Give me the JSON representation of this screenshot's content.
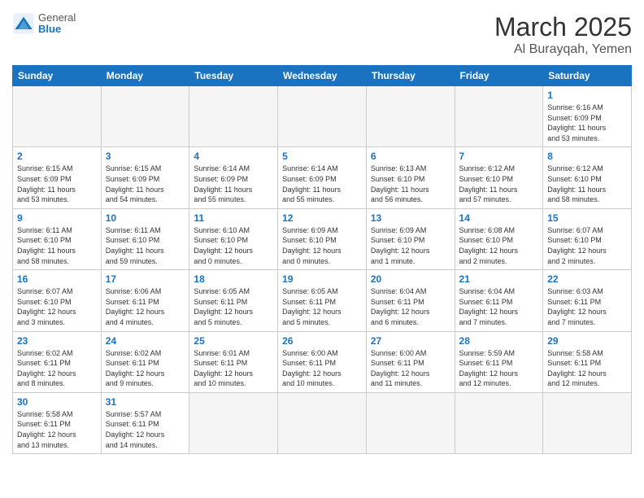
{
  "header": {
    "logo_general": "General",
    "logo_blue": "Blue",
    "title": "March 2025",
    "location": "Al Burayqah, Yemen"
  },
  "days_of_week": [
    "Sunday",
    "Monday",
    "Tuesday",
    "Wednesday",
    "Thursday",
    "Friday",
    "Saturday"
  ],
  "weeks": [
    [
      {
        "day": null,
        "info": ""
      },
      {
        "day": null,
        "info": ""
      },
      {
        "day": null,
        "info": ""
      },
      {
        "day": null,
        "info": ""
      },
      {
        "day": null,
        "info": ""
      },
      {
        "day": null,
        "info": ""
      },
      {
        "day": "1",
        "info": "Sunrise: 6:16 AM\nSunset: 6:09 PM\nDaylight: 11 hours\nand 53 minutes."
      }
    ],
    [
      {
        "day": "2",
        "info": "Sunrise: 6:15 AM\nSunset: 6:09 PM\nDaylight: 11 hours\nand 53 minutes."
      },
      {
        "day": "3",
        "info": "Sunrise: 6:15 AM\nSunset: 6:09 PM\nDaylight: 11 hours\nand 54 minutes."
      },
      {
        "day": "4",
        "info": "Sunrise: 6:14 AM\nSunset: 6:09 PM\nDaylight: 11 hours\nand 55 minutes."
      },
      {
        "day": "5",
        "info": "Sunrise: 6:14 AM\nSunset: 6:09 PM\nDaylight: 11 hours\nand 55 minutes."
      },
      {
        "day": "6",
        "info": "Sunrise: 6:13 AM\nSunset: 6:10 PM\nDaylight: 11 hours\nand 56 minutes."
      },
      {
        "day": "7",
        "info": "Sunrise: 6:12 AM\nSunset: 6:10 PM\nDaylight: 11 hours\nand 57 minutes."
      },
      {
        "day": "8",
        "info": "Sunrise: 6:12 AM\nSunset: 6:10 PM\nDaylight: 11 hours\nand 58 minutes."
      }
    ],
    [
      {
        "day": "9",
        "info": "Sunrise: 6:11 AM\nSunset: 6:10 PM\nDaylight: 11 hours\nand 58 minutes."
      },
      {
        "day": "10",
        "info": "Sunrise: 6:11 AM\nSunset: 6:10 PM\nDaylight: 11 hours\nand 59 minutes."
      },
      {
        "day": "11",
        "info": "Sunrise: 6:10 AM\nSunset: 6:10 PM\nDaylight: 12 hours\nand 0 minutes."
      },
      {
        "day": "12",
        "info": "Sunrise: 6:09 AM\nSunset: 6:10 PM\nDaylight: 12 hours\nand 0 minutes."
      },
      {
        "day": "13",
        "info": "Sunrise: 6:09 AM\nSunset: 6:10 PM\nDaylight: 12 hours\nand 1 minute."
      },
      {
        "day": "14",
        "info": "Sunrise: 6:08 AM\nSunset: 6:10 PM\nDaylight: 12 hours\nand 2 minutes."
      },
      {
        "day": "15",
        "info": "Sunrise: 6:07 AM\nSunset: 6:10 PM\nDaylight: 12 hours\nand 2 minutes."
      }
    ],
    [
      {
        "day": "16",
        "info": "Sunrise: 6:07 AM\nSunset: 6:10 PM\nDaylight: 12 hours\nand 3 minutes."
      },
      {
        "day": "17",
        "info": "Sunrise: 6:06 AM\nSunset: 6:11 PM\nDaylight: 12 hours\nand 4 minutes."
      },
      {
        "day": "18",
        "info": "Sunrise: 6:05 AM\nSunset: 6:11 PM\nDaylight: 12 hours\nand 5 minutes."
      },
      {
        "day": "19",
        "info": "Sunrise: 6:05 AM\nSunset: 6:11 PM\nDaylight: 12 hours\nand 5 minutes."
      },
      {
        "day": "20",
        "info": "Sunrise: 6:04 AM\nSunset: 6:11 PM\nDaylight: 12 hours\nand 6 minutes."
      },
      {
        "day": "21",
        "info": "Sunrise: 6:04 AM\nSunset: 6:11 PM\nDaylight: 12 hours\nand 7 minutes."
      },
      {
        "day": "22",
        "info": "Sunrise: 6:03 AM\nSunset: 6:11 PM\nDaylight: 12 hours\nand 7 minutes."
      }
    ],
    [
      {
        "day": "23",
        "info": "Sunrise: 6:02 AM\nSunset: 6:11 PM\nDaylight: 12 hours\nand 8 minutes."
      },
      {
        "day": "24",
        "info": "Sunrise: 6:02 AM\nSunset: 6:11 PM\nDaylight: 12 hours\nand 9 minutes."
      },
      {
        "day": "25",
        "info": "Sunrise: 6:01 AM\nSunset: 6:11 PM\nDaylight: 12 hours\nand 10 minutes."
      },
      {
        "day": "26",
        "info": "Sunrise: 6:00 AM\nSunset: 6:11 PM\nDaylight: 12 hours\nand 10 minutes."
      },
      {
        "day": "27",
        "info": "Sunrise: 6:00 AM\nSunset: 6:11 PM\nDaylight: 12 hours\nand 11 minutes."
      },
      {
        "day": "28",
        "info": "Sunrise: 5:59 AM\nSunset: 6:11 PM\nDaylight: 12 hours\nand 12 minutes."
      },
      {
        "day": "29",
        "info": "Sunrise: 5:58 AM\nSunset: 6:11 PM\nDaylight: 12 hours\nand 12 minutes."
      }
    ],
    [
      {
        "day": "30",
        "info": "Sunrise: 5:58 AM\nSunset: 6:11 PM\nDaylight: 12 hours\nand 13 minutes."
      },
      {
        "day": "31",
        "info": "Sunrise: 5:57 AM\nSunset: 6:11 PM\nDaylight: 12 hours\nand 14 minutes."
      },
      {
        "day": null,
        "info": ""
      },
      {
        "day": null,
        "info": ""
      },
      {
        "day": null,
        "info": ""
      },
      {
        "day": null,
        "info": ""
      },
      {
        "day": null,
        "info": ""
      }
    ]
  ]
}
